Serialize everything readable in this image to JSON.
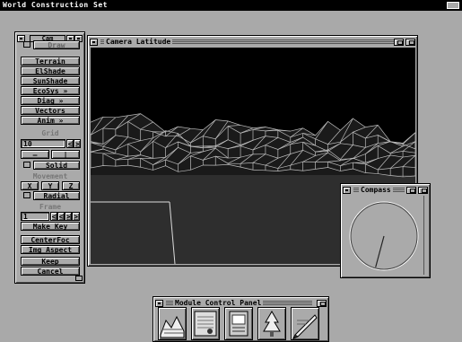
{
  "screen": {
    "title": "World Construction Set"
  },
  "control_panel": {
    "window_label": "Cam",
    "draw_label": "Draw",
    "buttons": {
      "terrain": "Terrain",
      "elshade": "ElShade",
      "sunshade": "SunShade",
      "ecosys": "EcoSys »",
      "diag": "Diag »",
      "vectors": "Vectors",
      "anim": "Anim »"
    },
    "grid": {
      "header": "Grid",
      "value": "10",
      "dec_label": "<",
      "inc_label": ">",
      "minus_label": "—",
      "divide_label": "|",
      "solid_label": "Solid"
    },
    "movement": {
      "header": "Movement",
      "x_label": "X",
      "y_label": "Y",
      "z_label": "Z",
      "radial_label": "Radial"
    },
    "frame": {
      "header": "Frame",
      "value": "1",
      "nav_first": "<",
      "nav_prev": "<",
      "nav_next": ">",
      "nav_last": ">",
      "make_key": "Make Key"
    },
    "centerfoc": "CenterFoc",
    "img_aspect": "Img Aspect",
    "keep": "Keep",
    "cancel": "Cancel"
  },
  "camera_window": {
    "title": "Camera Latitude",
    "sky_color": "#000000",
    "ground_color": "#2e2e2e",
    "wire_color": "#bdbdbd"
  },
  "compass_window": {
    "title": "Compass",
    "needle_heading_deg": 195
  },
  "module_panel": {
    "title": "Module Control Panel",
    "modules": [
      {
        "icon": "terrain-editor-icon"
      },
      {
        "icon": "database-chart-icon"
      },
      {
        "icon": "parameters-book-icon"
      },
      {
        "icon": "ecosystem-icon"
      },
      {
        "icon": "drawing-tools-icon"
      }
    ]
  }
}
